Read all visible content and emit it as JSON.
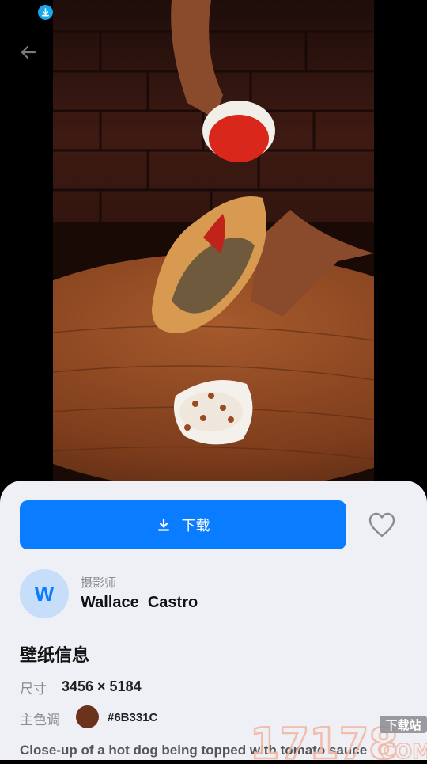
{
  "header": {
    "back_icon": "arrow-left-icon",
    "status_download_icon": "download-circle-icon"
  },
  "photo": {
    "subject": "hot-dog-with-tomato-sauce"
  },
  "actions": {
    "download_label": "下载",
    "download_icon": "download-icon",
    "favorite_icon": "heart-outline-icon",
    "accent_color": "#0A7CFF"
  },
  "photographer": {
    "avatar_letter": "W",
    "label": "摄影师",
    "name": "Wallace  Castro"
  },
  "info": {
    "title": "壁纸信息",
    "size_label": "尺寸",
    "size_value": "3456 × 5184",
    "color_label": "主色调",
    "color_hex": "#6B331C",
    "color_value": "#6B331C",
    "description": "Close-up of a hot dog being topped with tomato sauce"
  },
  "watermark": {
    "text": "17178",
    "badge": "下载站",
    "suffix": "COM"
  }
}
